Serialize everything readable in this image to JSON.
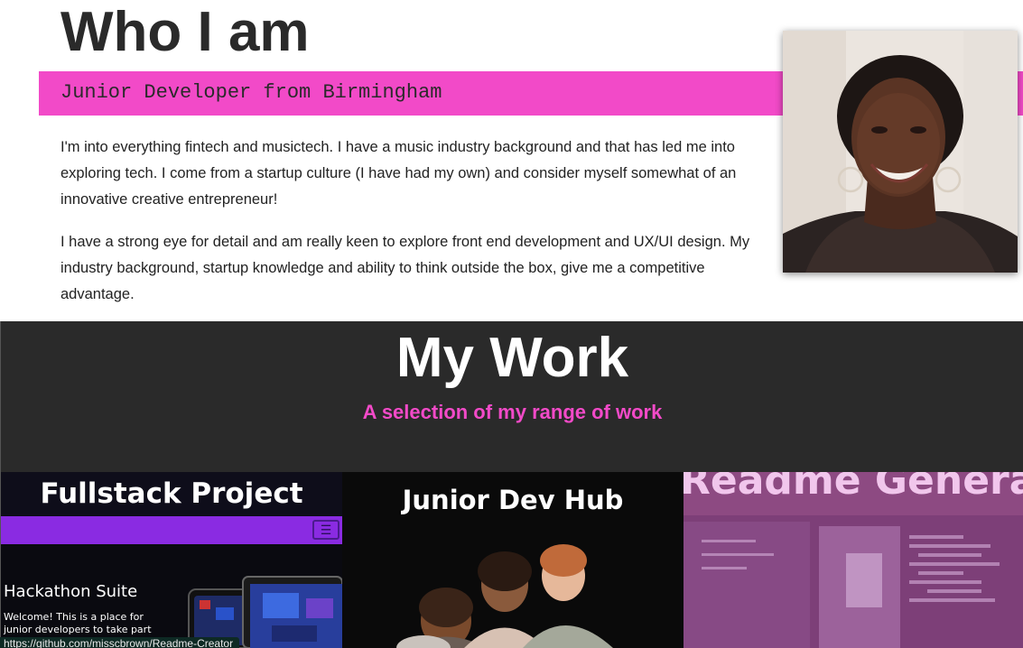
{
  "about": {
    "title": "Who I am",
    "subtitle": "Junior Developer from Birmingham",
    "paragraph_1": "I'm into everything fintech and musictech. I have a music industry background and that has led me into exploring tech. I come from a startup culture (I have had my own) and consider myself somewhat of an innovative creative entrepreneur!",
    "paragraph_2": "I have a strong eye for detail and am really keen to explore front end development and UX/UI design. My industry background, startup knowledge and ability to think outside the box, give me a competitive advantage."
  },
  "work": {
    "title": "My Work",
    "subtitle": "A selection of my range of work",
    "projects": [
      {
        "title": "Fullstack Project",
        "preview_heading": "Hackathon Suite",
        "preview_text": "Welcome! This is a place for junior developers to take part",
        "menu_icon": "hamburger-icon"
      },
      {
        "title": "Junior Dev Hub"
      },
      {
        "title": "Readme Generato"
      }
    ]
  },
  "status_bar": {
    "url": "https://github.com/misscbrown/Readme-Creator"
  },
  "colors": {
    "accent": "#f24ac8",
    "dark_section": "#2a2a2a",
    "text": "#2a2a2a"
  }
}
